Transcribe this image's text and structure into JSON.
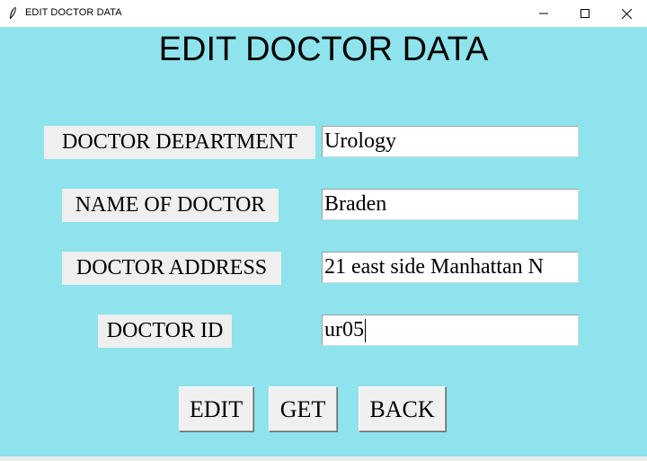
{
  "window": {
    "title": "EDIT DOCTOR DATA",
    "icon": "feather-icon",
    "controls": {
      "minimize": "minimize-icon",
      "maximize": "maximize-icon",
      "close": "close-icon"
    }
  },
  "form": {
    "heading": "EDIT DOCTOR DATA",
    "background_color": "#8ee3ec",
    "fields": [
      {
        "label": "DOCTOR DEPARTMENT",
        "value": "Urology"
      },
      {
        "label": "NAME OF DOCTOR",
        "value": "Braden"
      },
      {
        "label": "DOCTOR ADDRESS",
        "value": "21  east side Manhattan N"
      },
      {
        "label": "DOCTOR ID",
        "value": "ur05"
      }
    ],
    "buttons": {
      "edit": "EDIT",
      "get": "GET",
      "back": "BACK"
    }
  }
}
